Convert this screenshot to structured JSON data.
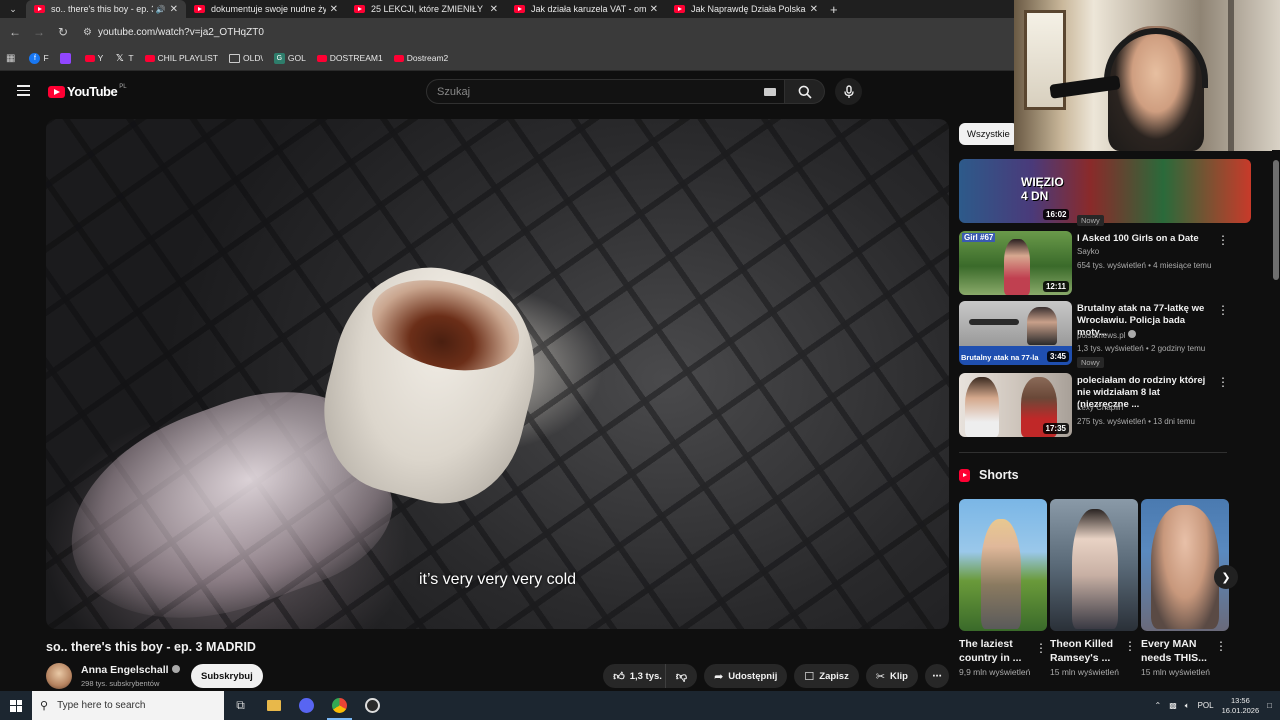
{
  "browser": {
    "tabs": [
      {
        "title": "so.. there's this boy - ep. 3 M",
        "active": true,
        "audio": true
      },
      {
        "title": "dokumentuje swoje nudne życie",
        "active": false
      },
      {
        "title": "25 LEKCJI, które ZMIENIŁY moje",
        "active": false
      },
      {
        "title": "Jak działa karuzela VAT - omów",
        "active": false
      },
      {
        "title": "Jak Naprawdę Działa Polska Mafia",
        "active": false
      }
    ],
    "url": "youtube.com/watch?v=ja2_OTHqZT0",
    "bookmarks": [
      {
        "label": "F",
        "icon": "facebook-icon"
      },
      {
        "label": "",
        "icon": "twitch-icon"
      },
      {
        "label": "Y",
        "icon": "youtube-icon"
      },
      {
        "label": "T",
        "icon": "x-icon"
      },
      {
        "label": "CHIL PLAYLIST",
        "icon": "youtube-icon"
      },
      {
        "label": "OLD\\",
        "icon": "folder-icon"
      },
      {
        "label": "GOL",
        "icon": "g-icon"
      },
      {
        "label": "DOSTREAM1",
        "icon": "youtube-icon"
      },
      {
        "label": "Dostream2",
        "icon": "youtube-icon"
      }
    ]
  },
  "youtube": {
    "logo_text": "YouTube",
    "country_code": "PL",
    "search_placeholder": "Szukaj",
    "video": {
      "subtitle": "it’s very very very cold",
      "title": "so.. there's this boy - ep. 3 MADRID",
      "channel": "Anna Engelschall",
      "subscribers": "298 tys. subskrybentów",
      "subscribe_label": "Subskrybuj",
      "likes": "1,3 tys.",
      "share_label": "Udostępnij",
      "save_label": "Zapisz",
      "clip_label": "Klip"
    },
    "filter_chip": "Wszystkie",
    "recommendations": [
      {
        "title": "",
        "channel": "",
        "meta": "",
        "duration": "16:02",
        "badge": "Nowy",
        "thumb_text": "WIĘZIO 4 DN"
      },
      {
        "title": "I Asked 100 Girls on a Date",
        "channel": "Sayko",
        "meta": "654 tys. wyświetleń • 4 miesiące temu",
        "duration": "12:11",
        "badge": "",
        "thumb_text": "Girl #67"
      },
      {
        "title": "Brutalny atak na 77-latkę we Wrocławiu. Policja bada moty...",
        "channel": "polsatnews.pl",
        "meta": "1,3 tys. wyświetleń • 2 godziny temu",
        "duration": "3:45",
        "badge": "Nowy",
        "thumb_text": "Brutalny atak na 77-la"
      },
      {
        "title": "poleciałam do rodziny której nie widziałam 8 lat (niezręczne ...",
        "channel": "Lexy Chaplin",
        "meta": "275 tys. wyświetleń • 13 dni temu",
        "duration": "17:35",
        "badge": "",
        "thumb_text": ""
      }
    ],
    "shorts_heading": "Shorts",
    "shorts": [
      {
        "title": "The laziest country in ...",
        "views": "9,9 mln wyświetleń"
      },
      {
        "title": "Theon Killed Ramsey's ...",
        "views": "15 mln wyświetleń"
      },
      {
        "title": "Every MAN needs THIS...",
        "views": "15 mln wyświetleń"
      }
    ]
  },
  "taskbar": {
    "search_placeholder": "Type here to search",
    "language": "POL",
    "time": "13:56",
    "date": "16.01.2026"
  },
  "colors": {
    "youtube_red": "#ff0033",
    "background": "#0f0f0f",
    "chip_bg": "#272727"
  }
}
